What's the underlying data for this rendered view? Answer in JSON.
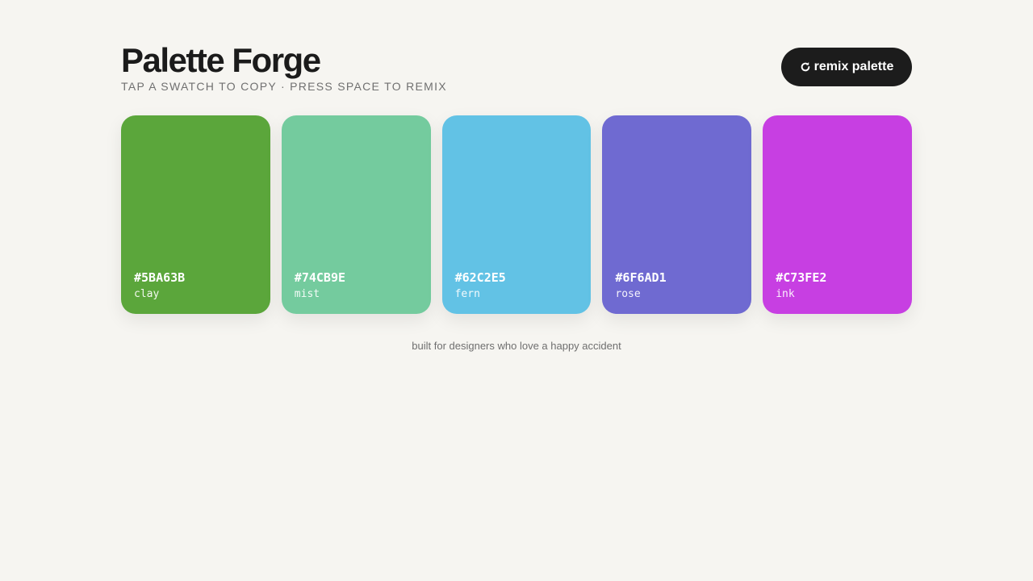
{
  "app": {
    "title": "Palette Forge",
    "subtitle": "TAP A SWATCH TO COPY · PRESS SPACE TO REMIX"
  },
  "toolbar": {
    "remix_icon": "refresh-icon",
    "remix_label": "remix palette"
  },
  "swatches": [
    {
      "hex": "#5BA63B",
      "name": "clay",
      "color": "#5BA63B"
    },
    {
      "hex": "#74CB9E",
      "name": "mist",
      "color": "#74CB9E"
    },
    {
      "hex": "#62C2E5",
      "name": "fern",
      "color": "#62C2E5"
    },
    {
      "hex": "#6F6AD1",
      "name": "rose",
      "color": "#6F6AD1"
    },
    {
      "hex": "#C73FE2",
      "name": "ink",
      "color": "#C73FE2"
    }
  ],
  "footer": {
    "text": "built for designers who love a happy accident"
  },
  "colors": {
    "background": "#f6f5f1",
    "button_bg": "#1c1c1c",
    "button_text": "#ffffff"
  }
}
